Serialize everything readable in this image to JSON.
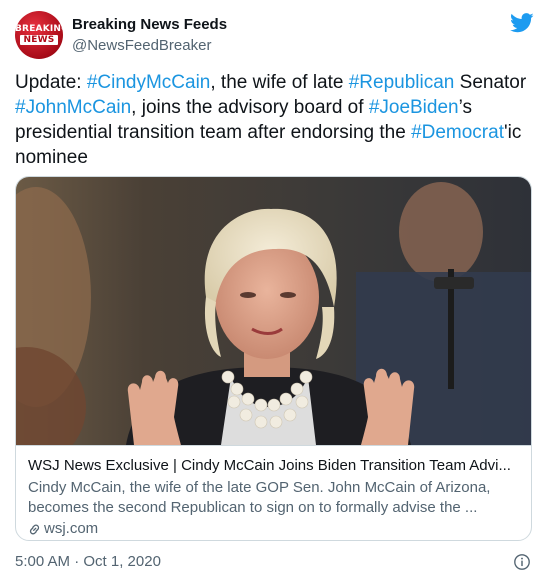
{
  "header": {
    "display_name": "Breaking News Feeds",
    "handle": "@NewsFeedBreaker",
    "avatar_line1": "BREAKING",
    "avatar_line2": "NEWS"
  },
  "tweet": {
    "segments": [
      {
        "text": "Update: ",
        "type": "text"
      },
      {
        "text": "#CindyMcCain",
        "type": "hashtag"
      },
      {
        "text": ", the wife of late ",
        "type": "text"
      },
      {
        "text": "#Republican",
        "type": "hashtag"
      },
      {
        "text": " Senator ",
        "type": "text"
      },
      {
        "text": "#JohnMcCain",
        "type": "hashtag"
      },
      {
        "text": ", joins the advisory board of ",
        "type": "text"
      },
      {
        "text": "#JoeBiden",
        "type": "hashtag"
      },
      {
        "text": "’s presidential transition team after endorsing the ",
        "type": "text"
      },
      {
        "text": "#Democrat",
        "type": "hashtag"
      },
      {
        "text": "'ic nominee",
        "type": "text"
      }
    ]
  },
  "card": {
    "title": "WSJ News Exclusive | Cindy McCain Joins Biden Transition Team Advi...",
    "description": "Cindy McCain, the wife of the late GOP Sen. John McCain of Arizona, becomes the second Republican to sign on to formally advise the ...",
    "domain": "wsj.com"
  },
  "footer": {
    "timestamp": "5:00 AM · Oct 1, 2020"
  },
  "colors": {
    "hashtag": "#1b95e0",
    "twitter_blue": "#1d9bf0",
    "avatar_red": "#c8101e"
  },
  "icons": [
    "twitter-bird-icon",
    "link-icon",
    "info-icon"
  ]
}
